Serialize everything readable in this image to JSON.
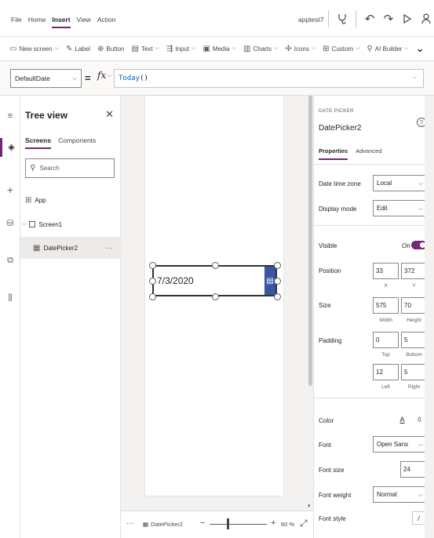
{
  "menu": {
    "items": [
      "File",
      "Home",
      "Insert",
      "View",
      "Action"
    ],
    "active": "Insert",
    "app_name": "apptest7"
  },
  "toolbar_icons": [
    "stethoscope-icon",
    "undo-icon",
    "redo-icon",
    "play-icon",
    "user-icon",
    "help-icon"
  ],
  "ribbon": {
    "items": [
      {
        "label": "New screen",
        "icon": "screen-icon",
        "has_menu": true
      },
      {
        "label": "Label",
        "icon": "label-icon",
        "has_menu": false
      },
      {
        "label": "Button",
        "icon": "button-icon",
        "has_menu": false
      },
      {
        "label": "Text",
        "icon": "text-icon",
        "has_menu": true
      },
      {
        "label": "Input",
        "icon": "input-icon",
        "has_menu": true
      },
      {
        "label": "Media",
        "icon": "media-icon",
        "has_menu": true
      },
      {
        "label": "Charts",
        "icon": "charts-icon",
        "has_menu": true
      },
      {
        "label": "Icons",
        "icon": "icons-icon",
        "has_menu": true
      },
      {
        "label": "Custom",
        "icon": "custom-icon",
        "has_menu": true
      },
      {
        "label": "AI Builder",
        "icon": "ai-builder-icon",
        "has_menu": true
      }
    ]
  },
  "formula": {
    "property": "DefaultDate",
    "fx_label": "fx",
    "func": "Today",
    "parens": "()"
  },
  "tree": {
    "title": "Tree view",
    "tabs": [
      "Screens",
      "Components"
    ],
    "active_tab": "Screens",
    "search_placeholder": "Search",
    "items": {
      "app": "App",
      "screen": "Screen1",
      "control": "DatePicker2"
    },
    "more": "···"
  },
  "canvas": {
    "datepicker_value": "7/3/2020"
  },
  "statusbar": {
    "dots": "···",
    "crumb": "DatePicker2",
    "zoom": "60 %"
  },
  "props": {
    "type_label": "DATE PICKER",
    "control_name": "DatePicker2",
    "tabs": [
      "Properties",
      "Advanced"
    ],
    "active_tab": "Properties",
    "date_time_zone_label": "Date time zone",
    "date_time_zone_value": "Local",
    "display_mode_label": "Display mode",
    "display_mode_value": "Edit",
    "visible_label": "Visible",
    "visible_state": "On",
    "position_label": "Position",
    "position_x": "33",
    "position_y": "372",
    "x_label": "X",
    "y_label": "Y",
    "size_label": "Size",
    "size_width": "575",
    "size_height": "70",
    "width_label": "Width",
    "height_label": "Height",
    "padding_label": "Padding",
    "padding_top": "0",
    "padding_bottom": "5",
    "padding_left": "12",
    "padding_right": "5",
    "top_label": "Top",
    "bottom_label": "Bottom",
    "left_label": "Left",
    "right_label": "Right",
    "color_label": "Color",
    "font_label": "Font",
    "font_value": "Open Sans",
    "font_size_label": "Font size",
    "font_size_value": "24",
    "font_weight_label": "Font weight",
    "font_weight_value": "Normal",
    "font_style_label": "Font style",
    "font_style_value": "/"
  },
  "colors": {
    "accent": "#742774",
    "datepicker_button": "#3955a3",
    "formula_token": "#0060c8"
  }
}
